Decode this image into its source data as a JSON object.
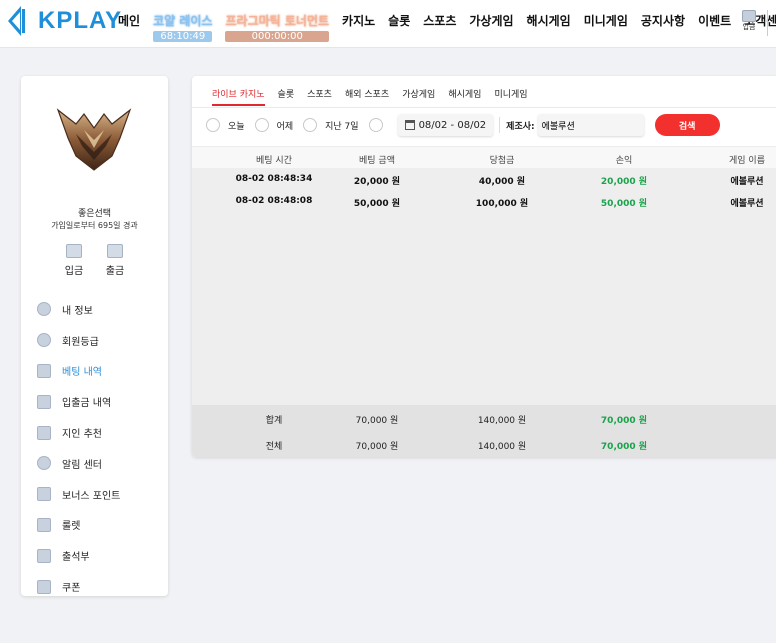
{
  "brand": {
    "name": "KPLAY"
  },
  "nav": {
    "items": [
      "메인",
      "카지노",
      "슬롯",
      "스포츠",
      "가상게임",
      "해시게임",
      "미니게임",
      "공지사항",
      "이벤트",
      "고객센터"
    ],
    "race": {
      "label": "코얄 레이스",
      "timer": "68:10:49"
    },
    "tournament": {
      "label": "프라그마틱 토너먼트",
      "timer": "000:00:00"
    },
    "deposit_label": "입금"
  },
  "sidebar": {
    "user_name": "좋은선택",
    "since": "가입일로부터 695일 경과",
    "quick": [
      "입금",
      "출금"
    ],
    "menu": [
      "내 정보",
      "회원등급",
      "베팅 내역",
      "입출금 내역",
      "지인 추천",
      "알림 센터",
      "보너스 포인트",
      "룰렛",
      "출석부",
      "쿠폰"
    ],
    "active_index": 2
  },
  "tabs": [
    "라이브 카지노",
    "슬롯",
    "스포츠",
    "해외 스포츠",
    "가상게임",
    "해시게임",
    "미니게임"
  ],
  "filters": {
    "options": [
      "오늘",
      "어제",
      "지난 7일"
    ],
    "date_range": "08/02 - 08/02",
    "maker_label": "제조사:",
    "maker_value": "에볼루션",
    "search_label": "검색"
  },
  "table": {
    "headers": [
      "베팅 시간",
      "베팅 금액",
      "당첨금",
      "손익",
      "게임 이름"
    ],
    "rows": [
      [
        "08-02 08:48:34",
        "20,000 원",
        "40,000 원",
        "20,000 원",
        "에볼루션"
      ],
      [
        "08-02 08:48:08",
        "50,000 원",
        "100,000 원",
        "50,000 원",
        "에볼루션"
      ]
    ],
    "footer": [
      [
        "합계",
        "70,000 원",
        "140,000 원",
        "70,000 원"
      ],
      [
        "전체",
        "70,000 원",
        "140,000 원",
        "70,000 원"
      ]
    ]
  },
  "colors": {
    "accent": "#e0282e",
    "brand": "#1e8fd8",
    "profit": "#1aa34a"
  }
}
